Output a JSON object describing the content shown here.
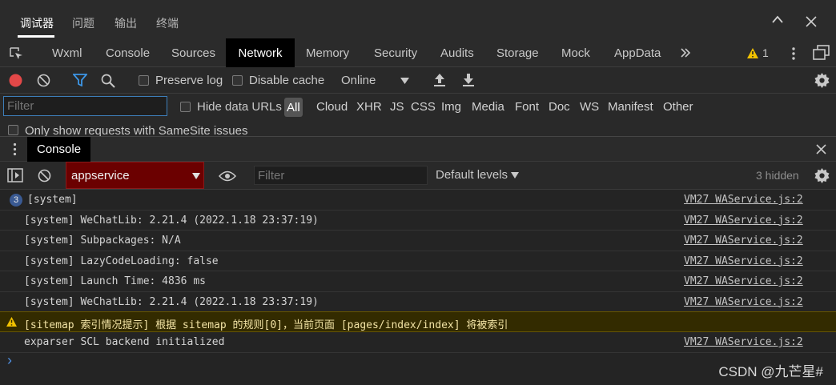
{
  "top_tabs": [
    "调试器",
    "问题",
    "输出",
    "终端"
  ],
  "devtools_tabs": [
    "Wxml",
    "Console",
    "Sources",
    "Network",
    "Memory",
    "Security",
    "Audits",
    "Storage",
    "Mock",
    "AppData"
  ],
  "warning_count": "1",
  "network_toolbar": {
    "preserve_log": "Preserve log",
    "disable_cache": "Disable cache",
    "throttle": "Online"
  },
  "filter_bar": {
    "placeholder": "Filter",
    "hide_data_urls": "Hide data URLs",
    "types": [
      "All",
      "Cloud",
      "XHR",
      "JS",
      "CSS",
      "Img",
      "Media",
      "Font",
      "Doc",
      "WS",
      "Manifest",
      "Other"
    ]
  },
  "samesite_label": "Only show requests with SameSite issues",
  "drawer": {
    "tab": "Console"
  },
  "console_toolbar": {
    "context": "appservice",
    "filter_placeholder": "Filter",
    "levels": "Default levels",
    "hidden": "3 hidden"
  },
  "messages": [
    {
      "count": "3",
      "text": "[system]",
      "source": "VM27 WAService.js:2"
    },
    {
      "text": "[system] WeChatLib: 2.21.4 (2022.1.18 23:37:19)",
      "source": "VM27 WAService.js:2"
    },
    {
      "text": "[system] Subpackages: N/A",
      "source": "VM27 WAService.js:2"
    },
    {
      "text": "[system] LazyCodeLoading: false",
      "source": "VM27 WAService.js:2"
    },
    {
      "text": "[system] Launch Time: 4836 ms",
      "source": "VM27 WAService.js:2"
    },
    {
      "text": "[system] WeChatLib: 2.21.4 (2022.1.18 23:37:19)",
      "source": "VM27 WAService.js:2"
    },
    {
      "text": "[sitemap 索引情况提示] 根据 sitemap 的规则[0]，当前页面 [pages/index/index] 将被索引"
    },
    {
      "text": "exparser SCL backend initialized",
      "source": "VM27 WAService.js:2"
    }
  ],
  "prompt": "›",
  "watermark": "CSDN @九芒星#",
  "colors": {
    "record": "#e34848",
    "filter_active": "#3d96e6",
    "context_bg": "#6b0000",
    "warn_bg": "#332b00",
    "warn_icon": "#f2c200"
  }
}
